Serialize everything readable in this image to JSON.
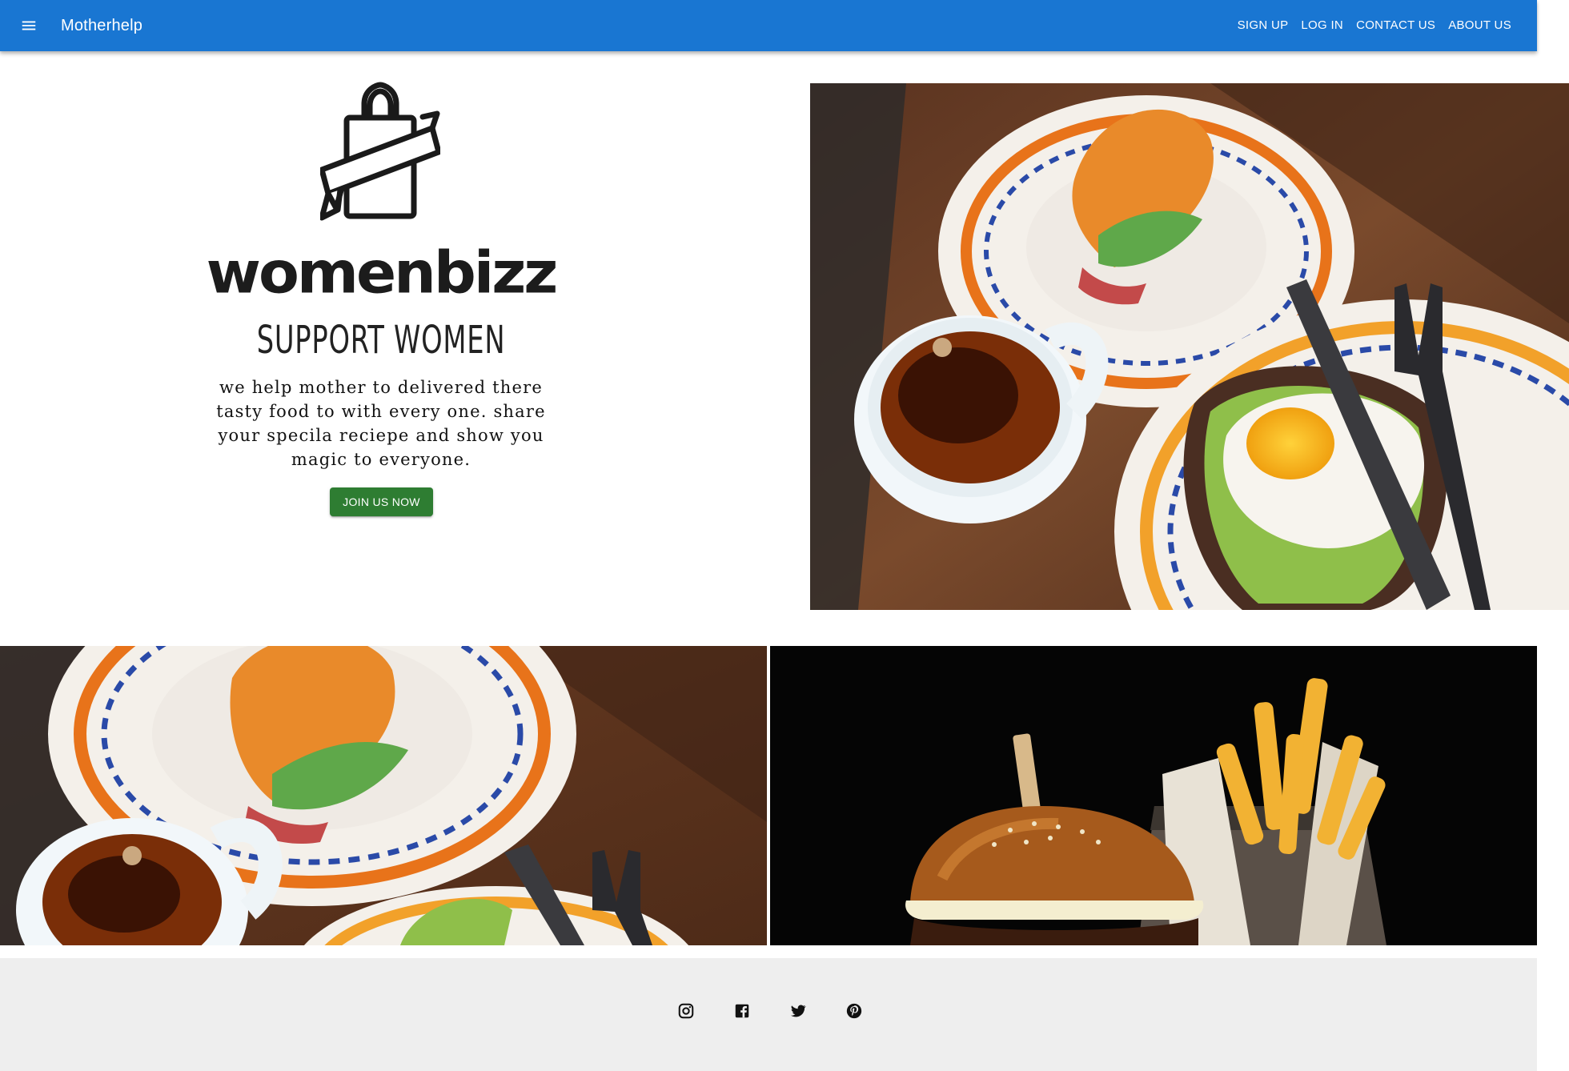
{
  "appbar": {
    "title": "Motherhelp",
    "menu_icon": "menu-icon",
    "nav": [
      "SIGN UP",
      "LOG IN",
      "CONTACT US",
      "ABOUT US"
    ],
    "color": "#1976d2"
  },
  "hero": {
    "logo_icon": "shopping-bag-ribbon-icon",
    "wordmark": "womenbizz",
    "tagline": "SUPPORT WOMEN",
    "description": "we help mother to delivered there tasty food to with every one. share your specila reciepe and show you magic to everyone.",
    "cta": "JOIN US NOW",
    "cta_color": "#2e7d32"
  },
  "photos": {
    "hero": "breakfast-table-photo",
    "gallery_left": "breakfast-table-photo-cropped",
    "gallery_right": "burger-and-fries-photo"
  },
  "footer": {
    "background": "#eeeeee",
    "socials": [
      "instagram-icon",
      "facebook-icon",
      "twitter-icon",
      "pinterest-icon"
    ]
  }
}
